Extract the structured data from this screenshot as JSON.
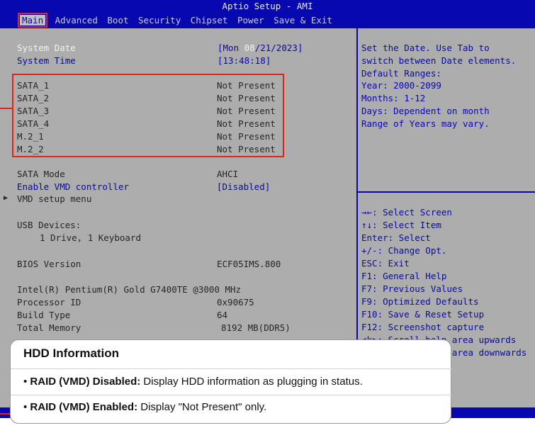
{
  "header": {
    "title": "Aptio Setup - AMI"
  },
  "menu": [
    {
      "label": "Main",
      "active": true
    },
    {
      "label": "Advanced"
    },
    {
      "label": "Boot"
    },
    {
      "label": "Security"
    },
    {
      "label": "Chipset"
    },
    {
      "label": "Power"
    },
    {
      "label": "Save & Exit"
    }
  ],
  "system": {
    "date_label": "System Date",
    "date_prefix": "[Mon ",
    "date_month": "08",
    "date_rest": "/21/2023]",
    "time_label": "System Time",
    "time_value": "[13:48:18]"
  },
  "drives": [
    {
      "label": "SATA_1",
      "value": "Not Present"
    },
    {
      "label": "SATA_2",
      "value": "Not Present"
    },
    {
      "label": "SATA_3",
      "value": "Not Present"
    },
    {
      "label": "SATA_4",
      "value": "Not Present"
    },
    {
      "label": "M.2_1",
      "value": "Not Present"
    },
    {
      "label": "M.2_2",
      "value": "Not Present"
    }
  ],
  "sata_mode": {
    "label": "SATA Mode",
    "value": "AHCI"
  },
  "vmd": {
    "label": "Enable VMD controller",
    "value": "[Disabled]"
  },
  "vmd_menu": {
    "label": "VMD setup menu"
  },
  "usb": {
    "label": "USB Devices:",
    "value": "1 Drive, 1 Keyboard"
  },
  "bios": {
    "label": "BIOS Version",
    "value": "ECF05IMS.800"
  },
  "cpu": {
    "label": "Intel(R) Pentium(R) Gold G7400TE @3000 MHz"
  },
  "processor_id": {
    "label": "Processor ID",
    "value": "0x90675"
  },
  "build_type": {
    "label": "Build Type",
    "value": "64"
  },
  "memory": {
    "label": "Total Memory",
    "value": "8192 MB(DDR5)"
  },
  "help_text": [
    "Set the Date. Use Tab to",
    "switch between Date elements.",
    "Default Ranges:",
    "Year: 2000-2099",
    "Months: 1-12",
    "Days: Dependent on month",
    "Range of Years may vary."
  ],
  "keys": [
    "→←: Select Screen",
    "↑↓: Select Item",
    "Enter: Select",
    "+/-: Change Opt.",
    "ESC: Exit",
    "F1: General Help",
    "F7: Previous Values",
    "F9: Optimized Defaults",
    "F10: Save & Reset Setup",
    "F12: Screenshot capture",
    "<k>: Scroll help area upwards",
    "<m>: Scroll help area downwards"
  ],
  "overlay": {
    "title": "HDD Information",
    "items": [
      {
        "bold": "RAID (VMD) Disabled:",
        "text": " Display HDD information as plugging in status."
      },
      {
        "bold": "RAID (VMD) Enabled:",
        "text": " Display \"Not Present\" only."
      }
    ]
  },
  "colors": {
    "bios_bg": "#adadad",
    "bios_blue": "#0808b0",
    "highlight_red": "#e0241c"
  }
}
